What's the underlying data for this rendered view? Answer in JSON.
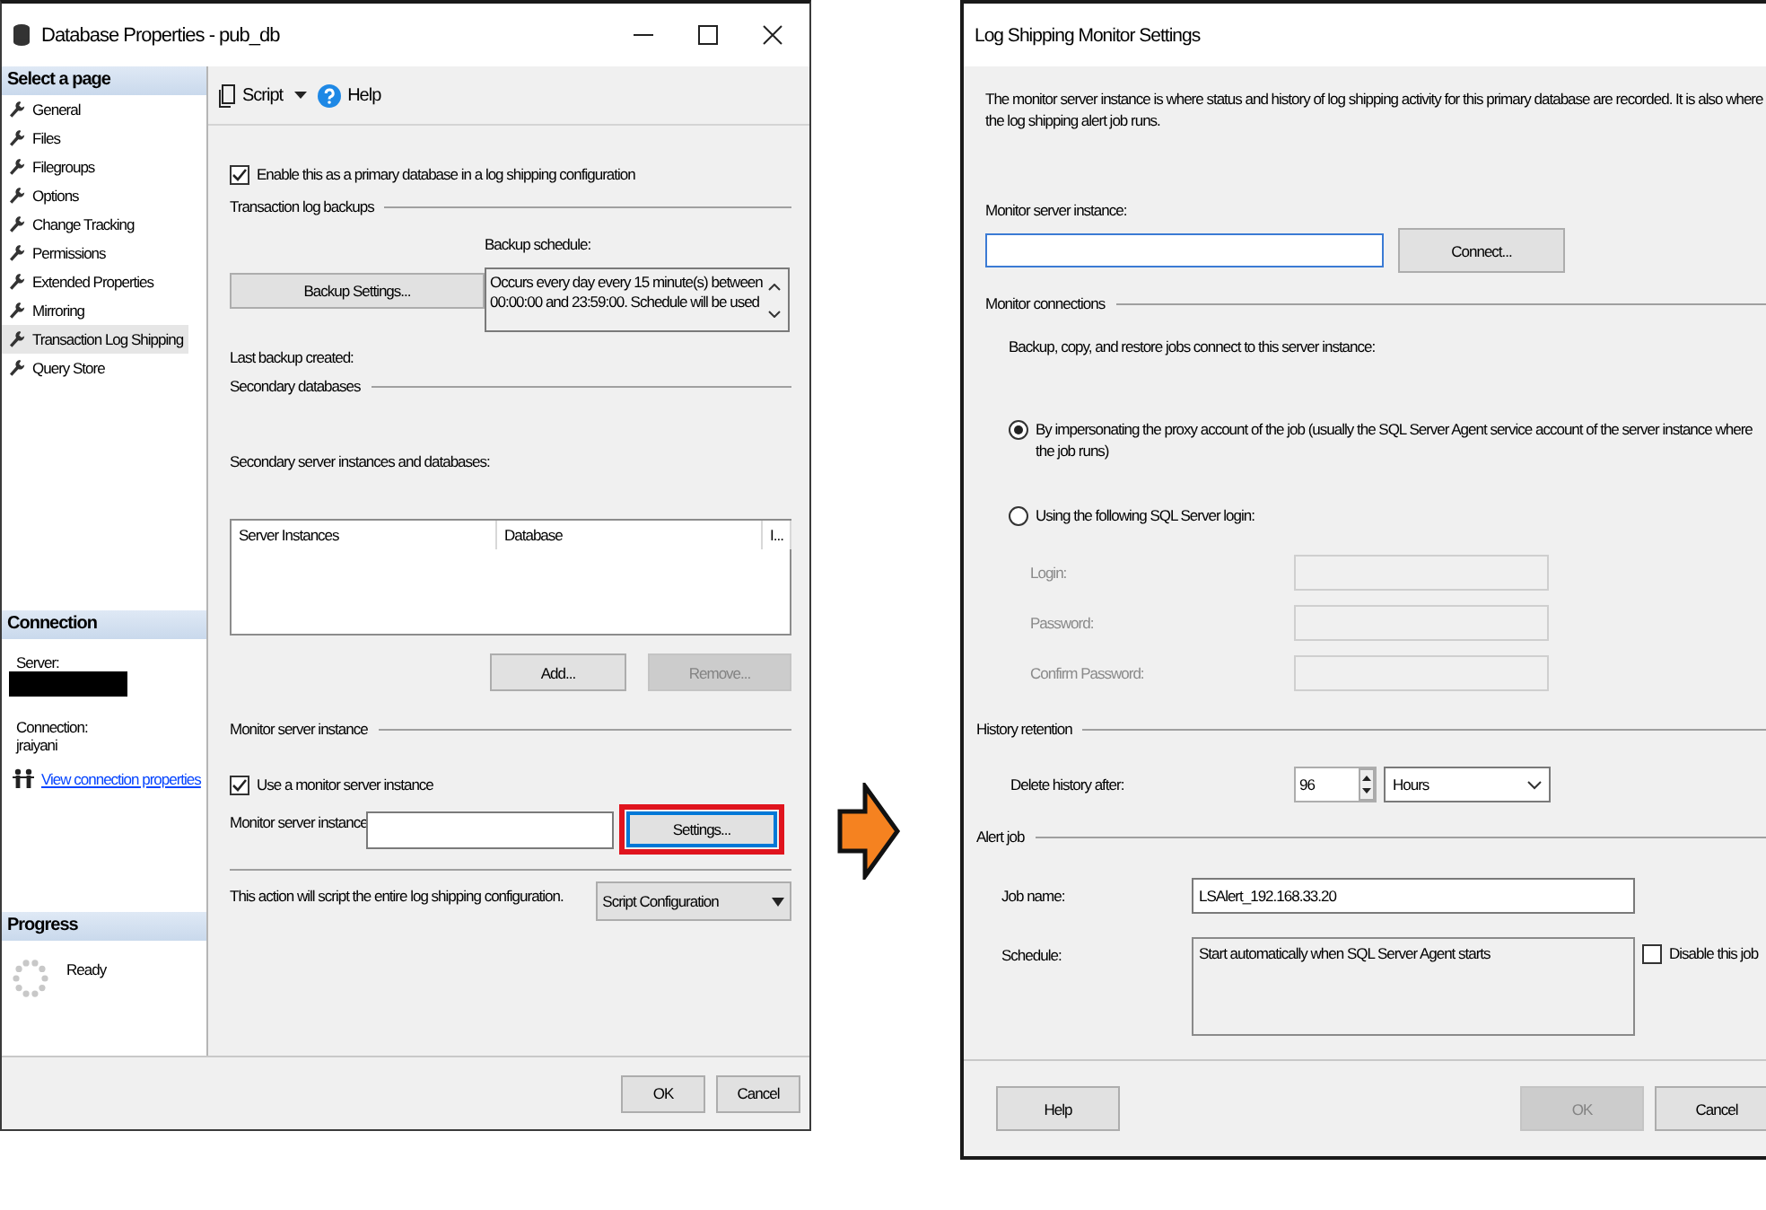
{
  "left_window": {
    "title": "Database Properties - pub_db",
    "sidebar": {
      "pages_header": "Select a page",
      "pages": [
        {
          "label": "General",
          "selected": false
        },
        {
          "label": "Files",
          "selected": false
        },
        {
          "label": "Filegroups",
          "selected": false
        },
        {
          "label": "Options",
          "selected": false
        },
        {
          "label": "Change Tracking",
          "selected": false
        },
        {
          "label": "Permissions",
          "selected": false
        },
        {
          "label": "Extended Properties",
          "selected": false
        },
        {
          "label": "Mirroring",
          "selected": false
        },
        {
          "label": "Transaction Log Shipping",
          "selected": true
        },
        {
          "label": "Query Store",
          "selected": false
        }
      ],
      "connection_header": "Connection",
      "server_label": "Server:",
      "connection_label": "Connection:",
      "connection_value": "jraiyani",
      "link": "View connection properties",
      "progress_header": "Progress",
      "progress_status": "Ready"
    },
    "toolbar": {
      "script": "Script",
      "help": "Help"
    },
    "content": {
      "enable_primary": {
        "label": "Enable this as a primary database in a log shipping configuration",
        "checked": true
      },
      "transaction_log_backups": "Transaction log backups",
      "backup_schedule_label": "Backup schedule:",
      "backup_settings_button": "Backup Settings...",
      "backup_schedule_text": "Occurs every day every 15 minute(s) between 00:00:00 and 23:59:00. Schedule will be used",
      "last_backup_label": "Last backup created:",
      "secondary_databases": "Secondary databases",
      "secondary_instances_label": "Secondary server instances and databases:",
      "table_columns": [
        "Server Instances",
        "Database",
        "I..."
      ],
      "add_button": {
        "label": "Add...",
        "disabled": false
      },
      "remove_button": {
        "label": "Remove...",
        "disabled": true
      },
      "monitor_section": "Monitor server instance",
      "use_monitor": {
        "label": "Use a monitor server instance",
        "checked": true
      },
      "monitor_instance_label": "Monitor server instance",
      "settings_button": "Settings...",
      "script_note": "This action will script the entire log shipping configuration.",
      "script_config_button": "Script Configuration"
    },
    "buttons": [
      {
        "label": "OK",
        "disabled": false
      },
      {
        "label": "Cancel",
        "disabled": false
      }
    ]
  },
  "right_window": {
    "title": "Log Shipping Monitor Settings",
    "description": "The monitor server instance is where status and history of log shipping activity for this primary database are recorded. It is also where the log shipping alert job runs.",
    "monitor_instance_label": "Monitor server instance:",
    "connect_button": "Connect...",
    "monitor_connections": "Monitor connections",
    "connections_note": "Backup, copy, and restore jobs connect to this server instance:",
    "options": [
      {
        "label": "By impersonating the proxy account of the job (usually the SQL Server Agent service account of the server instance where the job runs)",
        "selected": true
      },
      {
        "label": "Using the following SQL Server login:",
        "selected": false
      }
    ],
    "login_fields": [
      {
        "label": "Login:",
        "disabled": true
      },
      {
        "label": "Password:",
        "disabled": true
      },
      {
        "label": "Confirm Password:",
        "disabled": true
      }
    ],
    "history_retention": "History retention",
    "delete_history_label": "Delete history after:",
    "delete_history_value": "96",
    "delete_history_unit": "Hours",
    "alert_job": "Alert job",
    "job_name_label": "Job name:",
    "job_name_value": "LSAlert_192.168.33.20",
    "schedule_label": "Schedule:",
    "schedule_value": "Start automatically when SQL Server Agent starts",
    "disable_job": {
      "label": "Disable this job",
      "checked": false
    },
    "buttons": [
      {
        "label": "Help",
        "disabled": false
      },
      {
        "label": "OK",
        "disabled": true
      },
      {
        "label": "Cancel",
        "disabled": false
      }
    ]
  }
}
